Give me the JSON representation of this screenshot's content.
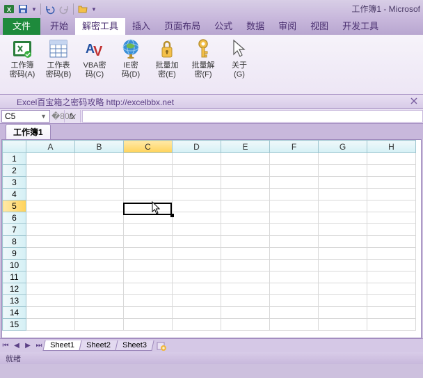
{
  "title": "工作簿1 - Microsof",
  "tabs": {
    "file": "文件",
    "items": [
      "开始",
      "解密工具",
      "插入",
      "页面布局",
      "公式",
      "数据",
      "审阅",
      "视图",
      "开发工具"
    ],
    "active_index": 1
  },
  "ribbon_groups": [
    {
      "icon": "workbook",
      "l1": "工作簿",
      "l2": "密码(A)"
    },
    {
      "icon": "sheet",
      "l1": "工作表",
      "l2": "密码(B)"
    },
    {
      "icon": "vba",
      "l1": "VBA密",
      "l2": "码(C)"
    },
    {
      "icon": "ie",
      "l1": "IE密",
      "l2": "码(D)"
    },
    {
      "icon": "lock",
      "l1": "批量加",
      "l2": "密(E)"
    },
    {
      "icon": "key",
      "l1": "批量解",
      "l2": "密(F)"
    },
    {
      "icon": "about",
      "l1": "关于",
      "l2": "(G)"
    }
  ],
  "infobar": "Excel百宝箱之密码攻略  http://excelbbx.net",
  "namebox": "C5",
  "fx_label": "fx",
  "workbook_tab": "工作簿1",
  "columns": [
    "A",
    "B",
    "C",
    "D",
    "E",
    "F",
    "G",
    "H"
  ],
  "rows": [
    "1",
    "2",
    "3",
    "4",
    "5",
    "6",
    "7",
    "8",
    "9",
    "10",
    "11",
    "12",
    "13",
    "14",
    "15"
  ],
  "active": {
    "col_index": 2,
    "row_index": 4
  },
  "sheet_tabs": [
    "Sheet1",
    "Sheet2",
    "Sheet3"
  ],
  "status": "就绪",
  "chart_data": null
}
